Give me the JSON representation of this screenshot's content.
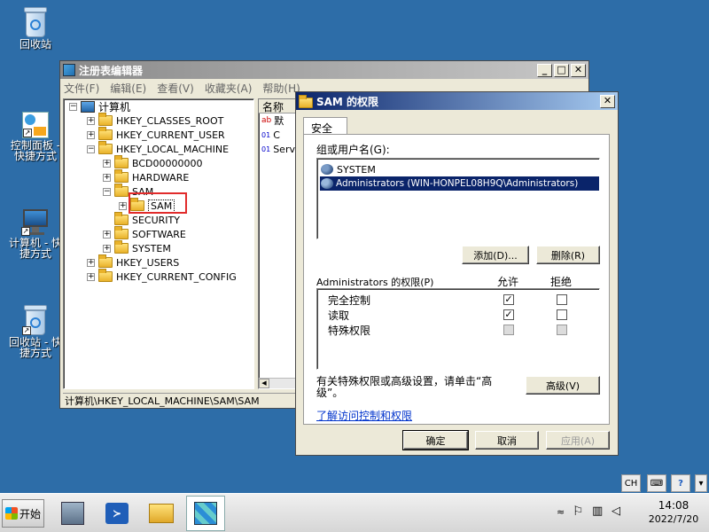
{
  "desktop": {
    "icons": [
      {
        "label": "回收站"
      },
      {
        "label": "控制面板 - 快捷方式"
      },
      {
        "label": "计算机 - 快捷方式"
      },
      {
        "label": "回收站 - 快捷方式"
      }
    ]
  },
  "regedit": {
    "title": "注册表编辑器",
    "menu": [
      "文件(F)",
      "编辑(E)",
      "查看(V)",
      "收藏夹(A)",
      "帮助(H)"
    ],
    "tree": {
      "root": "计算机",
      "nodes": [
        {
          "label": "HKEY_CLASSES_ROOT"
        },
        {
          "label": "HKEY_CURRENT_USER"
        },
        {
          "label": "HKEY_LOCAL_MACHINE"
        },
        {
          "label": "BCD00000000"
        },
        {
          "label": "HARDWARE"
        },
        {
          "label": "SAM"
        },
        {
          "label": "SAM"
        },
        {
          "label": "SECURITY"
        },
        {
          "label": "SOFTWARE"
        },
        {
          "label": "SYSTEM"
        },
        {
          "label": "HKEY_USERS"
        },
        {
          "label": "HKEY_CURRENT_CONFIG"
        }
      ]
    },
    "list_header": "名称",
    "list_items": [
      "默",
      "C",
      "Serv"
    ],
    "status": "计算机\\HKEY_LOCAL_MACHINE\\SAM\\SAM",
    "highlight_color": "#e12b2b"
  },
  "dialog": {
    "title": "SAM 的权限",
    "tab": "安全",
    "group_label": "组或用户名(G):",
    "users": [
      {
        "name": "SYSTEM",
        "selected": false
      },
      {
        "name": "Administrators (WIN-HONPEL08H9Q\\Administrators)",
        "selected": true
      }
    ],
    "add_button": "添加(D)...",
    "remove_button": "删除(R)",
    "perm_label": "Administrators 的权限(P)",
    "allow_header": "允许",
    "deny_header": "拒绝",
    "permissions": [
      {
        "name": "完全控制",
        "allow": "✓",
        "deny": ""
      },
      {
        "name": "读取",
        "allow": "✓",
        "deny": ""
      },
      {
        "name": "特殊权限",
        "allow": "",
        "deny": ""
      }
    ],
    "advanced_text": "有关特殊权限或高级设置，请单击“高级”。",
    "advanced_button": "高级(V)",
    "link": "了解访问控制和权限",
    "ok": "确定",
    "cancel": "取消",
    "apply": "应用(A)",
    "selection_color": "#0a246a"
  },
  "taskbar": {
    "start": "开始",
    "lang": "CH",
    "time": "14:08",
    "date": "2022/7/20"
  }
}
